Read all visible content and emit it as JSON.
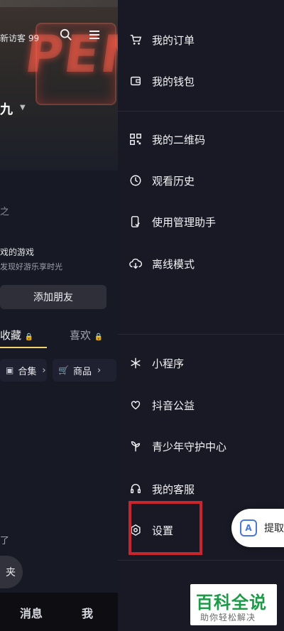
{
  "left_panel": {
    "visitor_text": "新访客 99",
    "name_fragment": "九",
    "line1": "之",
    "games_line1": "戏的游戏",
    "games_line2": "发现好游乐享时光",
    "add_friend_label": "添加朋友",
    "tab_collect": "收藏",
    "tab_like": "喜欢",
    "pill_collection_label": "合集",
    "pill_goods_label": "商品",
    "footer_text": "了",
    "footer_circle_text": "夹",
    "bottom_nav": {
      "messages": "消息",
      "me": "我"
    }
  },
  "drawer": {
    "items": [
      {
        "label": "我的订单",
        "icon": "cart-icon"
      },
      {
        "label": "我的钱包",
        "icon": "wallet-icon"
      },
      {
        "label": "我的二维码",
        "icon": "qr-code-icon"
      },
      {
        "label": "观看历史",
        "icon": "clock-icon"
      },
      {
        "label": "使用管理助手",
        "icon": "phone-check-icon"
      },
      {
        "label": "离线模式",
        "icon": "cloud-download-icon"
      },
      {
        "label": "小程序",
        "icon": "mini-program-icon"
      },
      {
        "label": "抖音公益",
        "icon": "heart-hand-icon"
      },
      {
        "label": "青少年守护中心",
        "icon": "sprout-icon"
      },
      {
        "label": "我的客服",
        "icon": "headset-icon"
      },
      {
        "label": "设置",
        "icon": "settings-hexagon-icon"
      }
    ]
  },
  "floating_button": {
    "label": "提取"
  },
  "watermark": {
    "title": "百科全说",
    "subtitle": "助你轻松解决"
  },
  "colors": {
    "highlight": "#c8262e",
    "drawer_bg": "#191925",
    "watermark_green": "#1d9a48"
  }
}
